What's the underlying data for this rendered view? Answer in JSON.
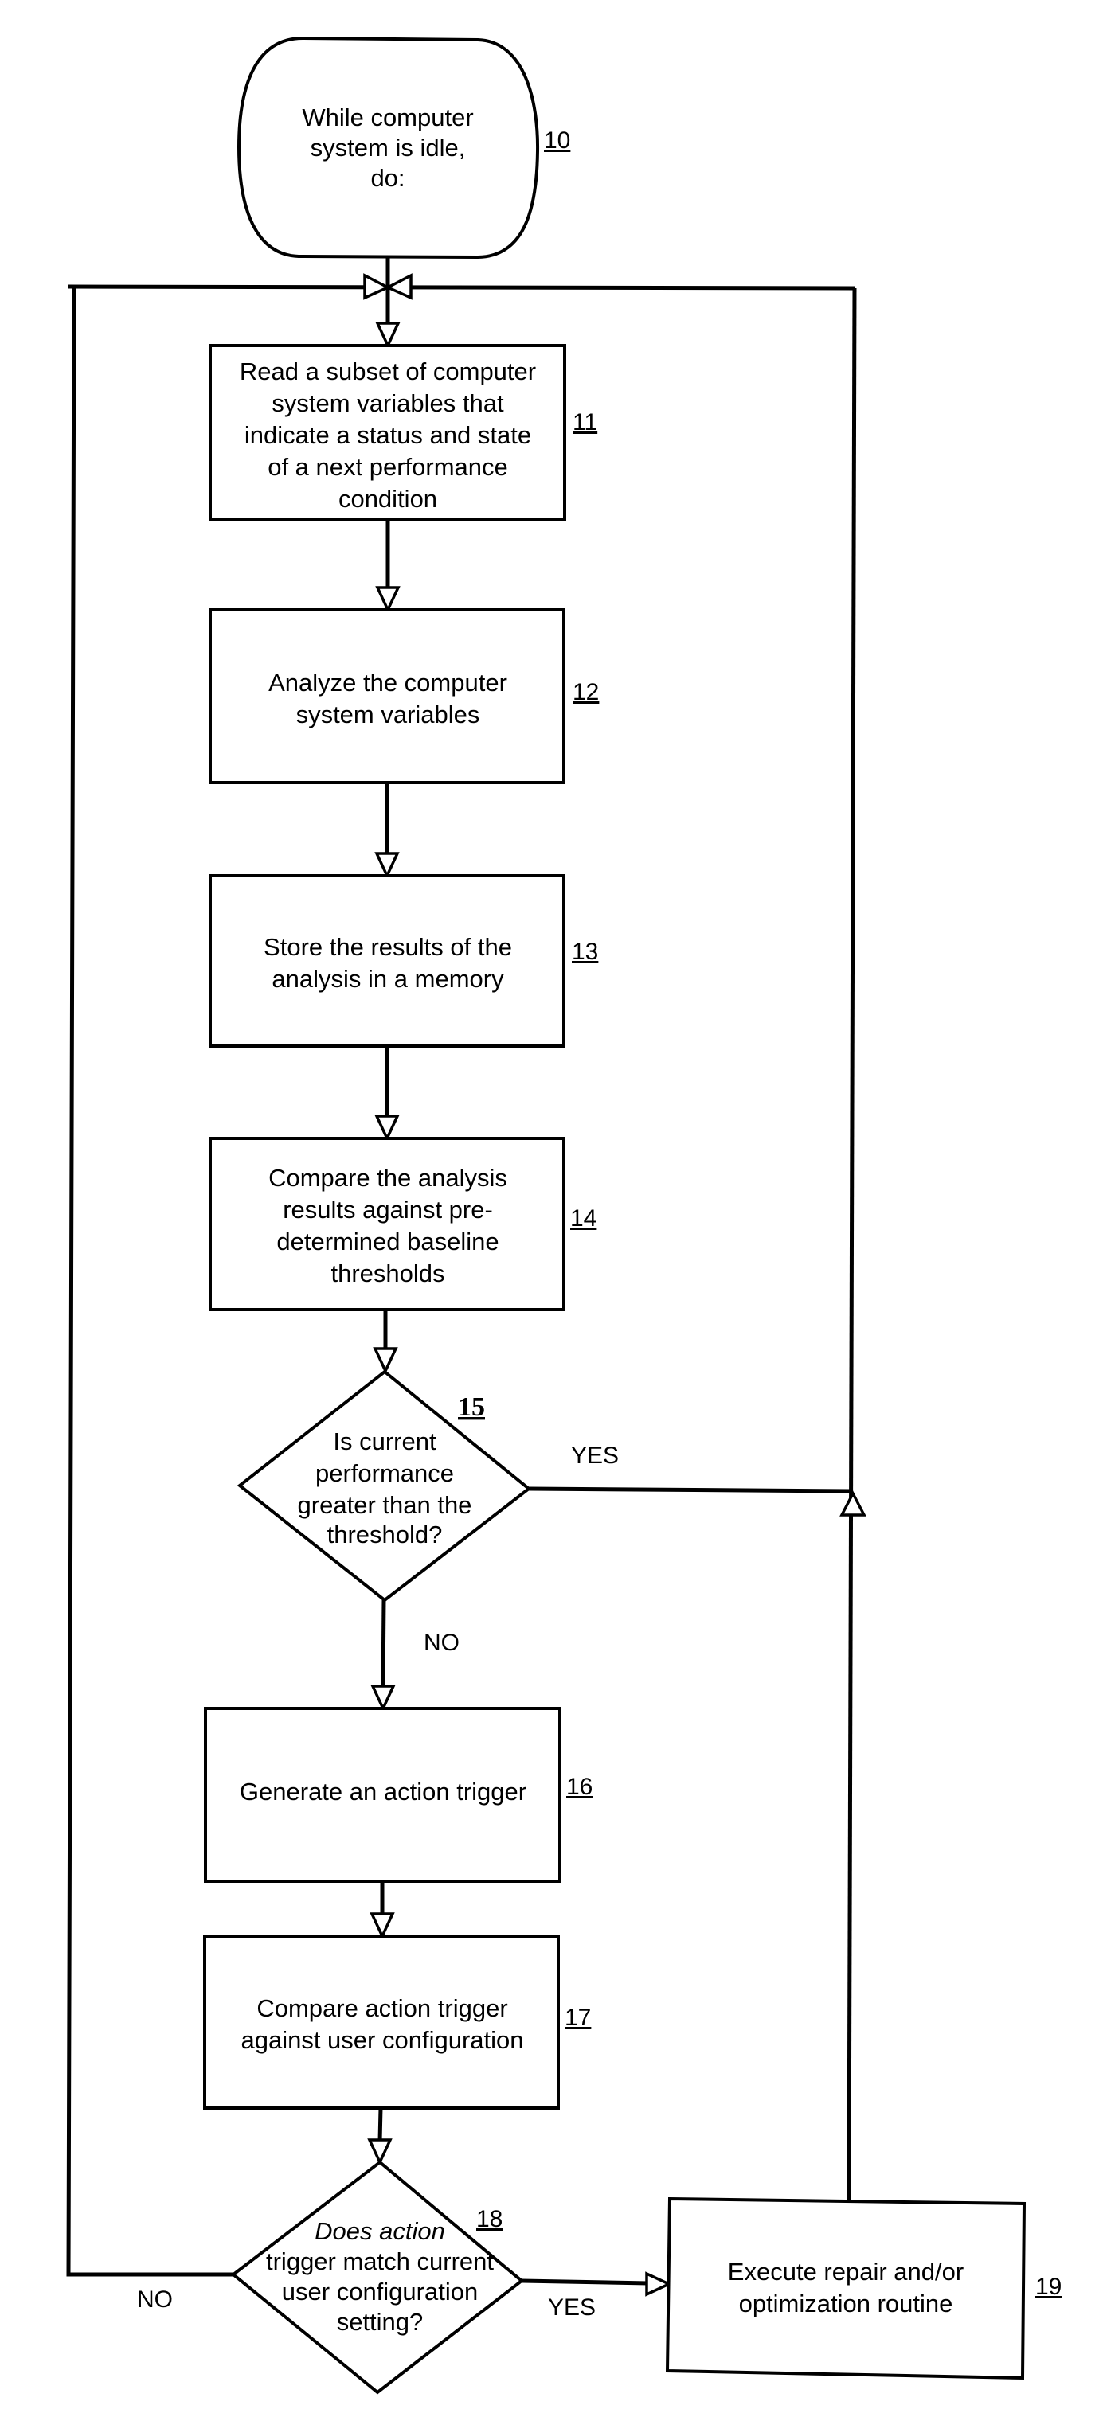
{
  "figure": {
    "start": {
      "ref": "10",
      "lines": [
        "While computer",
        "system is idle,",
        "do:"
      ]
    },
    "steps": [
      {
        "ref": "11",
        "lines": [
          "Read a subset of computer",
          "system variables that",
          "indicate a status and state",
          "of a next performance",
          "condition"
        ]
      },
      {
        "ref": "12",
        "lines": [
          "Analyze the computer",
          "system variables"
        ]
      },
      {
        "ref": "13",
        "lines": [
          "Store the results of the",
          "analysis in a memory"
        ]
      },
      {
        "ref": "14",
        "lines": [
          "Compare the analysis",
          "results against pre-",
          "determined baseline",
          "thresholds"
        ]
      },
      {
        "ref": "16",
        "lines": [
          "Generate an action trigger"
        ]
      },
      {
        "ref": "17",
        "lines": [
          "Compare action trigger",
          "against user configuration"
        ]
      },
      {
        "ref": "19",
        "lines": [
          "Execute repair and/or",
          "optimization routine"
        ]
      }
    ],
    "decisions": [
      {
        "ref": "15",
        "lines": [
          "Is current",
          "performance",
          "greater than the",
          "threshold?"
        ],
        "yes_label": "YES",
        "no_label": "NO"
      },
      {
        "ref": "18",
        "lines": [
          "Does action",
          "trigger match current",
          "user configuration",
          "setting?"
        ],
        "yes_label": "YES",
        "no_label": "NO"
      }
    ]
  }
}
